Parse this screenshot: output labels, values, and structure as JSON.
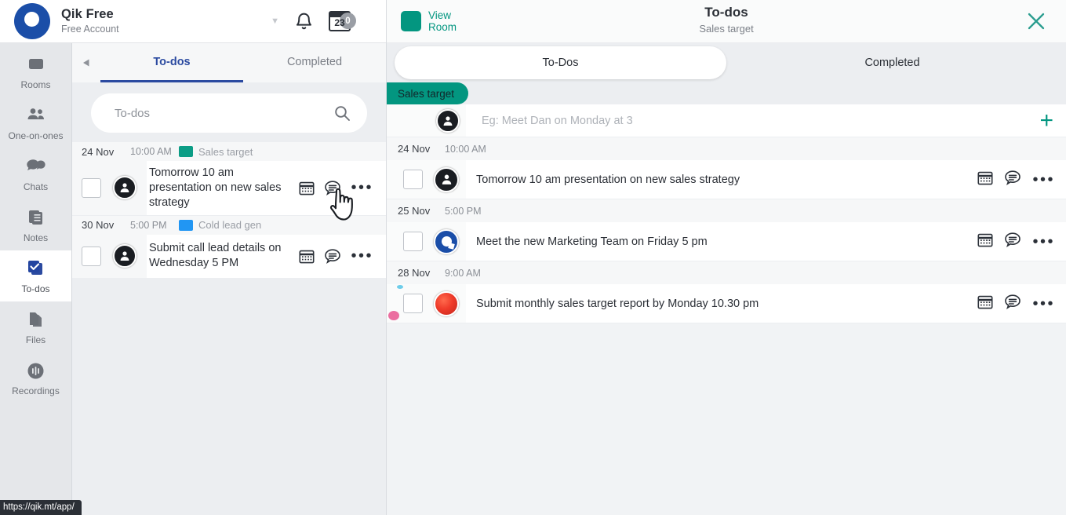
{
  "app": {
    "brand_title": "Qik Free",
    "brand_subtitle": "Free Account",
    "status_url": "https://qik.mt/app/",
    "accent_blue": "#2b4aa0",
    "accent_teal": "#039680",
    "logo_blue": "#1b4ea8"
  },
  "topbar": {
    "caret": "▼",
    "bell_name": "notifications",
    "calendar_day": "23",
    "calendar_badge": "0"
  },
  "sidebar": {
    "items": [
      {
        "label": "Rooms",
        "icon": "rooms-icon",
        "active": false
      },
      {
        "label": "One-on-ones",
        "icon": "people-icon",
        "active": false
      },
      {
        "label": "Chats",
        "icon": "chat-bubbles-icon",
        "active": false
      },
      {
        "label": "Notes",
        "icon": "notes-icon",
        "active": false
      },
      {
        "label": "To-dos",
        "icon": "checkbox-stack-icon",
        "active": true
      },
      {
        "label": "Files",
        "icon": "files-icon",
        "active": false
      },
      {
        "label": "Recordings",
        "icon": "recordings-icon",
        "active": false
      }
    ]
  },
  "left_panel": {
    "back_arrow": "◀",
    "tabs": [
      {
        "label": "To-dos",
        "active": true
      },
      {
        "label": "Completed",
        "active": false
      }
    ],
    "search": {
      "placeholder": "To-dos",
      "icon": "search-icon"
    },
    "groups": [
      {
        "date": "24 Nov",
        "time": "10:00 AM",
        "tag_label": "Sales target",
        "tag_color": "#0c9d86",
        "tasks": [
          {
            "text": "Tomorrow 10 am presentation on new sales strategy",
            "avatar": "person"
          }
        ]
      },
      {
        "date": "30 Nov",
        "time": "5:00 PM",
        "tag_label": "Cold lead gen",
        "tag_color": "#2196f3",
        "tasks": [
          {
            "text": "Submit call lead details on Wednesday 5 PM",
            "avatar": "person"
          }
        ]
      }
    ],
    "row_actions": {
      "calendar": "calendar-icon",
      "comment": "comment-icon",
      "more": "•••"
    }
  },
  "right_panel": {
    "view_room_line1": "View",
    "view_room_line2": "Room",
    "title": "To-dos",
    "subtitle": "Sales target",
    "close_label": "close",
    "tabs": [
      {
        "label": "To-Dos",
        "active": true
      },
      {
        "label": "Completed",
        "active": false
      }
    ],
    "chip_label": "Sales target",
    "add_row": {
      "placeholder": "Eg: Meet Dan on Monday at 3",
      "plus": "+",
      "avatar": "person"
    },
    "groups": [
      {
        "date": "24 Nov",
        "time": "10:00 AM",
        "tasks": [
          {
            "text": "Tomorrow 10 am presentation on new sales strategy",
            "avatar": "person"
          }
        ]
      },
      {
        "date": "25 Nov",
        "time": "5:00 PM",
        "tasks": [
          {
            "text": "Meet the new Marketing Team on Friday 5 pm",
            "avatar": "qik"
          }
        ]
      },
      {
        "date": "28 Nov",
        "time": "9:00 AM",
        "tasks": [
          {
            "text": "Submit monthly sales target report by Monday 10.30 pm",
            "avatar": "photo"
          }
        ]
      }
    ],
    "row_actions": {
      "calendar": "calendar-icon",
      "comment": "comment-icon",
      "more": "•••"
    }
  }
}
